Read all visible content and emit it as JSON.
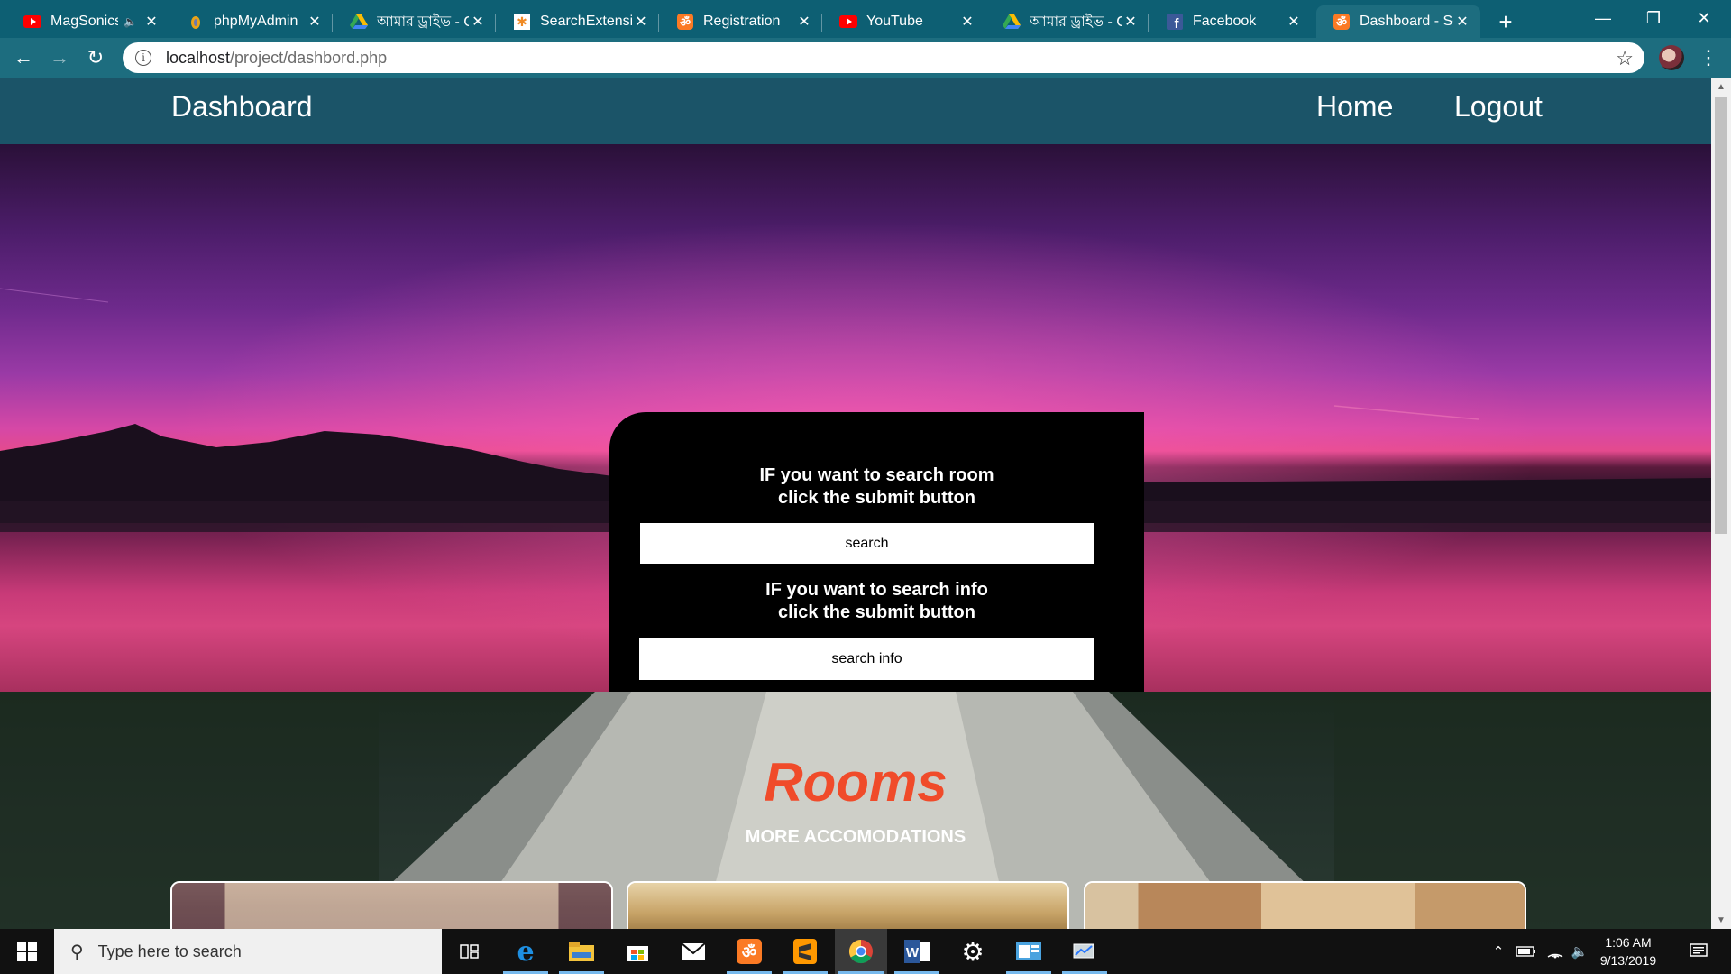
{
  "browser": {
    "tabs": [
      {
        "label": "MagSonics",
        "icon": "youtube-icon"
      },
      {
        "label": "phpMyAdmin",
        "icon": "phpmyadmin-icon"
      },
      {
        "label": "আমার ড্রাইভ - G",
        "icon": "google-drive-icon"
      },
      {
        "label": "SearchExtension",
        "icon": "search-extension-icon"
      },
      {
        "label": "Registration",
        "icon": "xampp-icon"
      },
      {
        "label": "YouTube",
        "icon": "youtube-icon"
      },
      {
        "label": "আমার ড্রাইভ - G",
        "icon": "google-drive-icon"
      },
      {
        "label": "Facebook",
        "icon": "facebook-icon"
      },
      {
        "label": "Dashboard - Sc",
        "icon": "xampp-icon",
        "active": true
      }
    ],
    "new_tab_symbol": "+",
    "window_controls": {
      "minimize": "—",
      "restore": "❐",
      "close": "✕"
    },
    "url_host": "localhost",
    "url_path": "/project/dashbord.php",
    "info_symbol": "i",
    "bookmark_symbol": "☆"
  },
  "site_nav": {
    "brand": "Dashboard",
    "home": "Home",
    "logout": "Logout"
  },
  "search_panel": {
    "room_line1": "IF you want to search room",
    "room_line2": "click the submit button",
    "room_button": "search",
    "info_line1": "IF you want to search info",
    "info_line2": "click the submit button",
    "info_button": "search info"
  },
  "rooms_section": {
    "title": "Rooms",
    "subtitle": "MORE ACCOMODATIONS",
    "card_count_visible": 3
  },
  "taskbar": {
    "search_placeholder": "Type here to search",
    "apps": [
      "task-view-icon",
      "edge-icon",
      "file-explorer-icon",
      "store-icon",
      "mail-icon",
      "xampp-icon",
      "sublime-text-icon",
      "chrome-icon",
      "word-icon",
      "settings-icon",
      "control-panel-icon",
      "network-icon"
    ],
    "time": "1:06 AM",
    "date": "9/13/2019"
  },
  "colors": {
    "tab_strip": "#0d5f73",
    "toolbar": "#1d6d7f",
    "site_nav": "#1b5468",
    "rooms_title": "#f04b2a",
    "panel": "#000000"
  }
}
